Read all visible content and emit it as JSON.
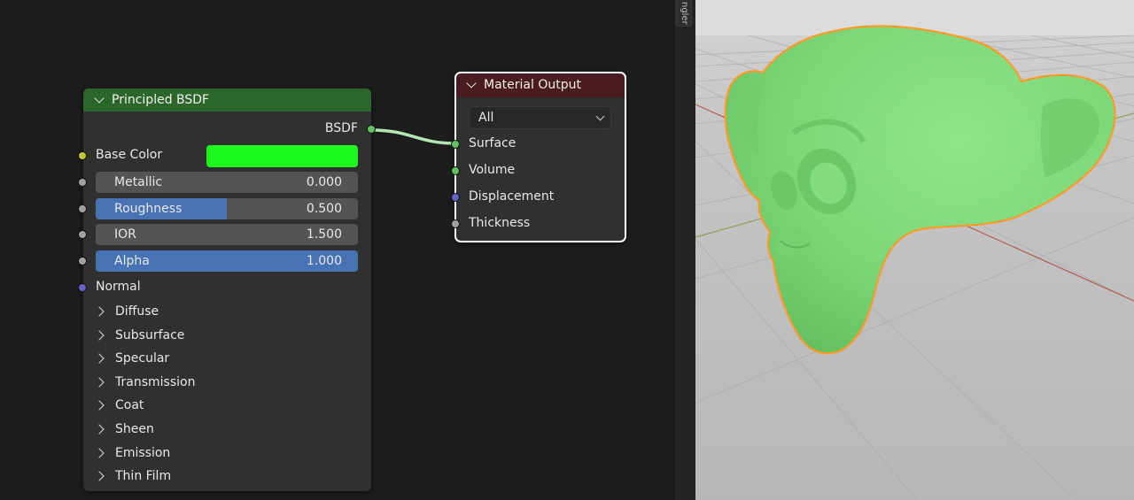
{
  "sidebar_tab": "ngler",
  "principled": {
    "title": "Principled BSDF",
    "output_label": "BSDF",
    "base_color_label": "Base Color",
    "base_color_value": "#1df91d",
    "fields": [
      {
        "name": "Metallic",
        "value": "0.000",
        "fill": 0.0
      },
      {
        "name": "Roughness",
        "value": "0.500",
        "fill": 0.5
      },
      {
        "name": "IOR",
        "value": "1.500",
        "fill": 0.0
      },
      {
        "name": "Alpha",
        "value": "1.000",
        "fill": 1.0
      }
    ],
    "normal_label": "Normal",
    "panels": [
      "Diffuse",
      "Subsurface",
      "Specular",
      "Transmission",
      "Coat",
      "Sheen",
      "Emission",
      "Thin Film"
    ]
  },
  "material_output": {
    "title": "Material Output",
    "target": "All",
    "inputs": [
      "Surface",
      "Volume",
      "Displacement",
      "Thickness"
    ]
  },
  "colors": {
    "principled_header": "#2b662b",
    "output_header": "#4a1c22",
    "shader_socket": "#5fc45f",
    "color_socket": "#c7c729",
    "float_socket": "#a1a1a1",
    "vector_socket": "#6363c7",
    "link": "#b4e6b4",
    "field_accent": "#4772b3",
    "mesh_green": "#7ed97a",
    "selection_outline": "#ff9a2a"
  },
  "icons": {
    "collapse": "chevron-down-icon",
    "panel": "chevron-right-icon",
    "dropdown": "chevron-down-icon"
  }
}
